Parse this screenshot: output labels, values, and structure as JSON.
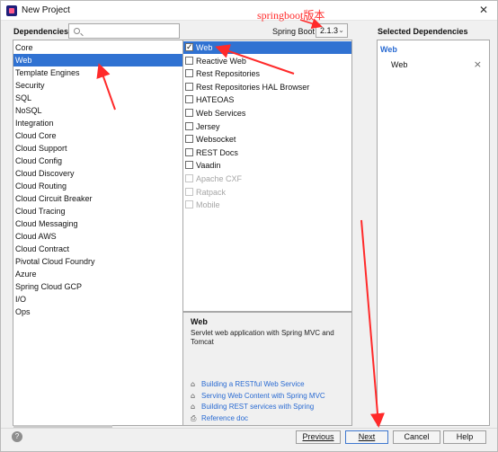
{
  "window": {
    "title": "New Project",
    "close_glyph": "✕"
  },
  "annotation": "springboot版本",
  "header": {
    "dependencies_label": "Dependencies",
    "search_placeholder": "",
    "spring_boot_label": "Spring Boot",
    "spring_boot_version": "2.1.3",
    "selected_label": "Selected Dependencies"
  },
  "categories": [
    "Core",
    "Web",
    "Template Engines",
    "Security",
    "SQL",
    "NoSQL",
    "Integration",
    "Cloud Core",
    "Cloud Support",
    "Cloud Config",
    "Cloud Discovery",
    "Cloud Routing",
    "Cloud Circuit Breaker",
    "Cloud Tracing",
    "Cloud Messaging",
    "Cloud AWS",
    "Cloud Contract",
    "Pivotal Cloud Foundry",
    "Azure",
    "Spring Cloud GCP",
    "I/O",
    "Ops"
  ],
  "selected_category": "Web",
  "dependencies": [
    {
      "label": "Web",
      "checked": true,
      "selected": true,
      "disabled": false
    },
    {
      "label": "Reactive Web",
      "checked": false,
      "selected": false,
      "disabled": false
    },
    {
      "label": "Rest Repositories",
      "checked": false,
      "selected": false,
      "disabled": false
    },
    {
      "label": "Rest Repositories HAL Browser",
      "checked": false,
      "selected": false,
      "disabled": false
    },
    {
      "label": "HATEOAS",
      "checked": false,
      "selected": false,
      "disabled": false
    },
    {
      "label": "Web Services",
      "checked": false,
      "selected": false,
      "disabled": false
    },
    {
      "label": "Jersey",
      "checked": false,
      "selected": false,
      "disabled": false
    },
    {
      "label": "Websocket",
      "checked": false,
      "selected": false,
      "disabled": false
    },
    {
      "label": "REST Docs",
      "checked": false,
      "selected": false,
      "disabled": false
    },
    {
      "label": "Vaadin",
      "checked": false,
      "selected": false,
      "disabled": false
    },
    {
      "label": "Apache CXF",
      "checked": false,
      "selected": false,
      "disabled": true
    },
    {
      "label": "Ratpack",
      "checked": false,
      "selected": false,
      "disabled": true
    },
    {
      "label": "Mobile",
      "checked": false,
      "selected": false,
      "disabled": true
    }
  ],
  "description": {
    "title": "Web",
    "text": "Servlet web application with Spring MVC and Tomcat",
    "links": [
      {
        "label": "Building a RESTful Web Service",
        "icon": "home-icon"
      },
      {
        "label": "Serving Web Content with Spring MVC",
        "icon": "home-icon"
      },
      {
        "label": "Building REST services with Spring",
        "icon": "home-icon"
      },
      {
        "label": "Reference doc",
        "icon": "doc-icon"
      }
    ]
  },
  "selected": {
    "group": "Web",
    "items": [
      "Web"
    ],
    "remove_glyph": "×"
  },
  "footer": {
    "help_glyph": "?",
    "previous": "Previous",
    "next": "Next",
    "cancel": "Cancel",
    "help": "Help"
  },
  "colors": {
    "selection": "#3072d2",
    "link": "#2a6bd2",
    "annotation": "#ff2a2a"
  }
}
